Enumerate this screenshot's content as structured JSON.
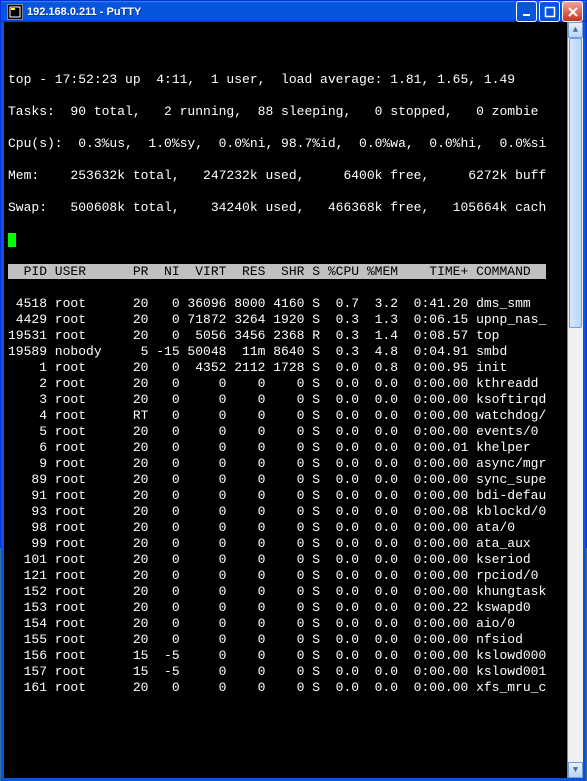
{
  "window": {
    "title": "192.168.0.211 - PuTTY",
    "icon_name": "putty-icon"
  },
  "summary": {
    "line1": "top - 17:52:23 up  4:11,  1 user,  load average: 1.81, 1.65, 1.49",
    "line2": "Tasks:  90 total,   2 running,  88 sleeping,   0 stopped,   0 zombie",
    "line3": "Cpu(s):  0.3%us,  1.0%sy,  0.0%ni, 98.7%id,  0.0%wa,  0.0%hi,  0.0%si",
    "line4": "Mem:    253632k total,   247232k used,     6400k free,     6272k buff",
    "line5": "Swap:   500608k total,    34240k used,   466368k free,   105664k cach"
  },
  "headers": [
    "PID",
    "USER",
    "PR",
    "NI",
    "VIRT",
    "RES",
    "SHR",
    "S",
    "%CPU",
    "%MEM",
    "TIME+",
    "COMMAND"
  ],
  "rows": [
    {
      "pid": "4518",
      "user": "root",
      "pr": "20",
      "ni": "0",
      "virt": "36096",
      "res": "8000",
      "shr": "4160",
      "s": "S",
      "cpu": "0.7",
      "mem": "3.2",
      "time": "0:41.20",
      "cmd": "dms_smm"
    },
    {
      "pid": "4429",
      "user": "root",
      "pr": "20",
      "ni": "0",
      "virt": "71872",
      "res": "3264",
      "shr": "1920",
      "s": "S",
      "cpu": "0.3",
      "mem": "1.3",
      "time": "0:06.15",
      "cmd": "upnp_nas_"
    },
    {
      "pid": "19531",
      "user": "root",
      "pr": "20",
      "ni": "0",
      "virt": "5056",
      "res": "3456",
      "shr": "2368",
      "s": "R",
      "cpu": "0.3",
      "mem": "1.4",
      "time": "0:08.57",
      "cmd": "top"
    },
    {
      "pid": "19589",
      "user": "nobody",
      "pr": "5",
      "ni": "-15",
      "virt": "50048",
      "res": "11m",
      "shr": "8640",
      "s": "S",
      "cpu": "0.3",
      "mem": "4.8",
      "time": "0:04.91",
      "cmd": "smbd"
    },
    {
      "pid": "1",
      "user": "root",
      "pr": "20",
      "ni": "0",
      "virt": "4352",
      "res": "2112",
      "shr": "1728",
      "s": "S",
      "cpu": "0.0",
      "mem": "0.8",
      "time": "0:00.95",
      "cmd": "init"
    },
    {
      "pid": "2",
      "user": "root",
      "pr": "20",
      "ni": "0",
      "virt": "0",
      "res": "0",
      "shr": "0",
      "s": "S",
      "cpu": "0.0",
      "mem": "0.0",
      "time": "0:00.00",
      "cmd": "kthreadd"
    },
    {
      "pid": "3",
      "user": "root",
      "pr": "20",
      "ni": "0",
      "virt": "0",
      "res": "0",
      "shr": "0",
      "s": "S",
      "cpu": "0.0",
      "mem": "0.0",
      "time": "0:00.00",
      "cmd": "ksoftirqd"
    },
    {
      "pid": "4",
      "user": "root",
      "pr": "RT",
      "ni": "0",
      "virt": "0",
      "res": "0",
      "shr": "0",
      "s": "S",
      "cpu": "0.0",
      "mem": "0.0",
      "time": "0:00.00",
      "cmd": "watchdog/"
    },
    {
      "pid": "5",
      "user": "root",
      "pr": "20",
      "ni": "0",
      "virt": "0",
      "res": "0",
      "shr": "0",
      "s": "S",
      "cpu": "0.0",
      "mem": "0.0",
      "time": "0:00.00",
      "cmd": "events/0"
    },
    {
      "pid": "6",
      "user": "root",
      "pr": "20",
      "ni": "0",
      "virt": "0",
      "res": "0",
      "shr": "0",
      "s": "S",
      "cpu": "0.0",
      "mem": "0.0",
      "time": "0:00.01",
      "cmd": "khelper"
    },
    {
      "pid": "9",
      "user": "root",
      "pr": "20",
      "ni": "0",
      "virt": "0",
      "res": "0",
      "shr": "0",
      "s": "S",
      "cpu": "0.0",
      "mem": "0.0",
      "time": "0:00.00",
      "cmd": "async/mgr"
    },
    {
      "pid": "89",
      "user": "root",
      "pr": "20",
      "ni": "0",
      "virt": "0",
      "res": "0",
      "shr": "0",
      "s": "S",
      "cpu": "0.0",
      "mem": "0.0",
      "time": "0:00.00",
      "cmd": "sync_supe"
    },
    {
      "pid": "91",
      "user": "root",
      "pr": "20",
      "ni": "0",
      "virt": "0",
      "res": "0",
      "shr": "0",
      "s": "S",
      "cpu": "0.0",
      "mem": "0.0",
      "time": "0:00.00",
      "cmd": "bdi-defau"
    },
    {
      "pid": "93",
      "user": "root",
      "pr": "20",
      "ni": "0",
      "virt": "0",
      "res": "0",
      "shr": "0",
      "s": "S",
      "cpu": "0.0",
      "mem": "0.0",
      "time": "0:00.08",
      "cmd": "kblockd/0"
    },
    {
      "pid": "98",
      "user": "root",
      "pr": "20",
      "ni": "0",
      "virt": "0",
      "res": "0",
      "shr": "0",
      "s": "S",
      "cpu": "0.0",
      "mem": "0.0",
      "time": "0:00.00",
      "cmd": "ata/0"
    },
    {
      "pid": "99",
      "user": "root",
      "pr": "20",
      "ni": "0",
      "virt": "0",
      "res": "0",
      "shr": "0",
      "s": "S",
      "cpu": "0.0",
      "mem": "0.0",
      "time": "0:00.00",
      "cmd": "ata_aux"
    },
    {
      "pid": "101",
      "user": "root",
      "pr": "20",
      "ni": "0",
      "virt": "0",
      "res": "0",
      "shr": "0",
      "s": "S",
      "cpu": "0.0",
      "mem": "0.0",
      "time": "0:00.00",
      "cmd": "kseriod"
    },
    {
      "pid": "121",
      "user": "root",
      "pr": "20",
      "ni": "0",
      "virt": "0",
      "res": "0",
      "shr": "0",
      "s": "S",
      "cpu": "0.0",
      "mem": "0.0",
      "time": "0:00.00",
      "cmd": "rpciod/0"
    },
    {
      "pid": "152",
      "user": "root",
      "pr": "20",
      "ni": "0",
      "virt": "0",
      "res": "0",
      "shr": "0",
      "s": "S",
      "cpu": "0.0",
      "mem": "0.0",
      "time": "0:00.00",
      "cmd": "khungtask"
    },
    {
      "pid": "153",
      "user": "root",
      "pr": "20",
      "ni": "0",
      "virt": "0",
      "res": "0",
      "shr": "0",
      "s": "S",
      "cpu": "0.0",
      "mem": "0.0",
      "time": "0:00.22",
      "cmd": "kswapd0"
    },
    {
      "pid": "154",
      "user": "root",
      "pr": "20",
      "ni": "0",
      "virt": "0",
      "res": "0",
      "shr": "0",
      "s": "S",
      "cpu": "0.0",
      "mem": "0.0",
      "time": "0:00.00",
      "cmd": "aio/0"
    },
    {
      "pid": "155",
      "user": "root",
      "pr": "20",
      "ni": "0",
      "virt": "0",
      "res": "0",
      "shr": "0",
      "s": "S",
      "cpu": "0.0",
      "mem": "0.0",
      "time": "0:00.00",
      "cmd": "nfsiod"
    },
    {
      "pid": "156",
      "user": "root",
      "pr": "15",
      "ni": "-5",
      "virt": "0",
      "res": "0",
      "shr": "0",
      "s": "S",
      "cpu": "0.0",
      "mem": "0.0",
      "time": "0:00.00",
      "cmd": "kslowd000"
    },
    {
      "pid": "157",
      "user": "root",
      "pr": "15",
      "ni": "-5",
      "virt": "0",
      "res": "0",
      "shr": "0",
      "s": "S",
      "cpu": "0.0",
      "mem": "0.0",
      "time": "0:00.00",
      "cmd": "kslowd001"
    },
    {
      "pid": "161",
      "user": "root",
      "pr": "20",
      "ni": "0",
      "virt": "0",
      "res": "0",
      "shr": "0",
      "s": "S",
      "cpu": "0.0",
      "mem": "0.0",
      "time": "0:00.00",
      "cmd": "xfs_mru_c"
    }
  ]
}
